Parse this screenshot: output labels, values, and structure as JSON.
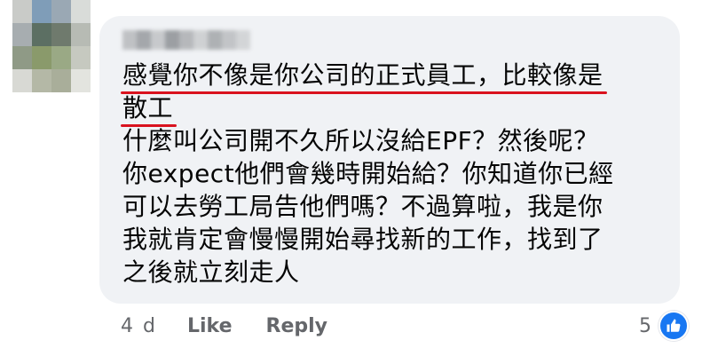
{
  "comment": {
    "lines": [
      "感覺你不像是你公司的正式員工，比較像是",
      "散工",
      "什麼叫公司開不久所以沒給EPF？然後呢？",
      "你expect他們會幾時開始給？你知道你已經",
      "可以去勞工局告他們嗎？不過算啦，我是你",
      "我就肯定會慢慢開始尋找新的工作，找到了",
      "之後就立刻走人"
    ]
  },
  "actions": {
    "age": "4 d",
    "like_label": "Like",
    "reply_label": "Reply"
  },
  "reactions": {
    "count": "5",
    "icon": "thumbs-up-icon"
  },
  "colors": {
    "bubble": "#f0f2f5",
    "text": "#050505",
    "meta": "#65676b",
    "underline": "#d9121e",
    "like_blue": "#1877f2"
  }
}
